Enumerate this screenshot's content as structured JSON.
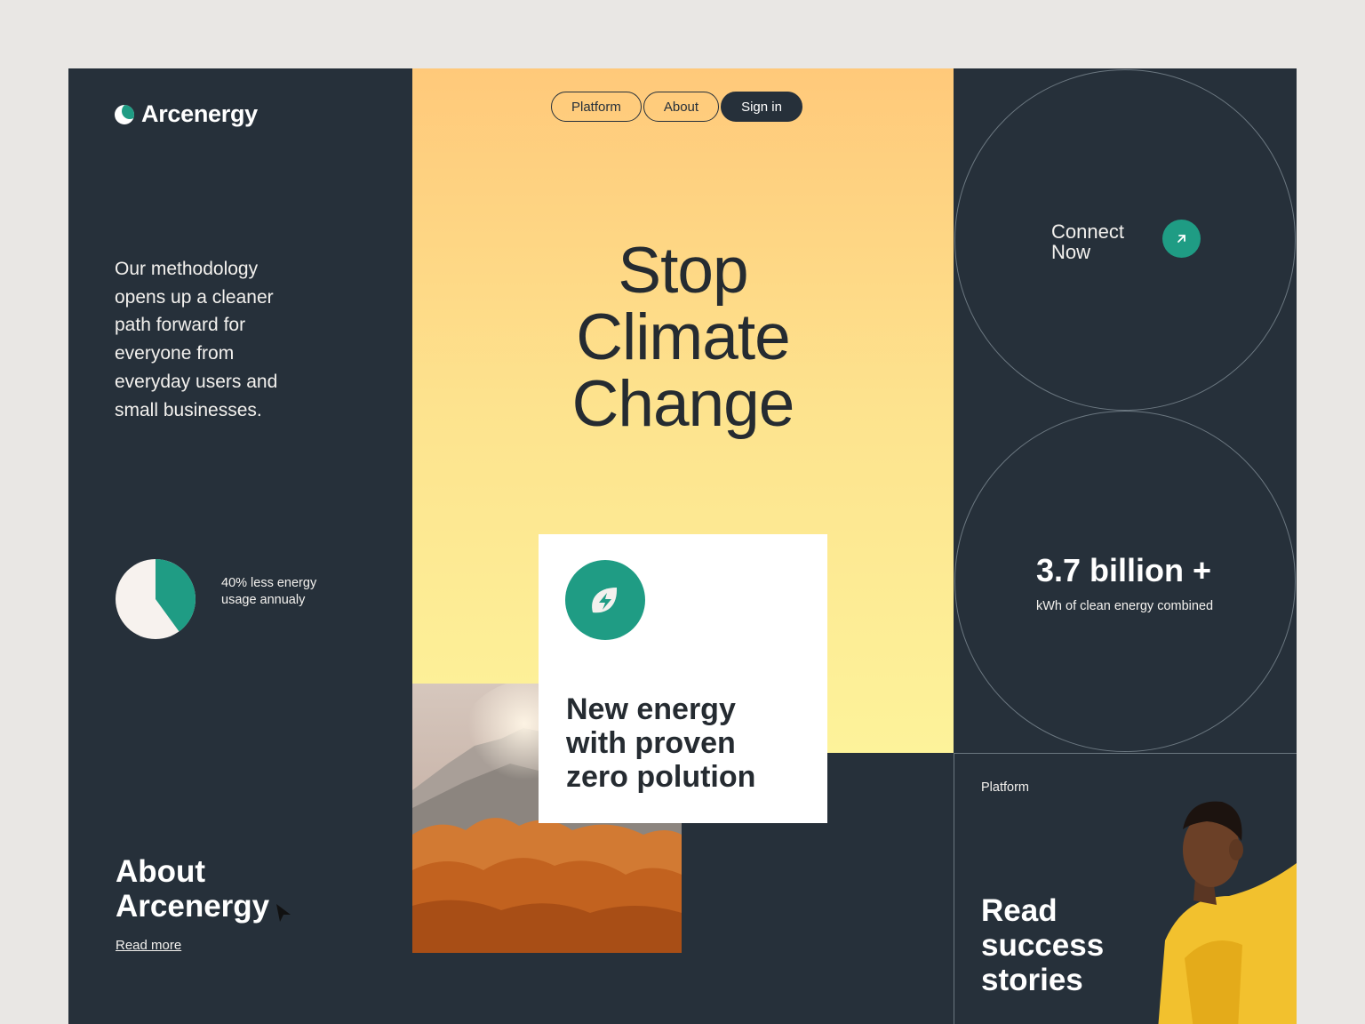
{
  "brand": {
    "name": "Arcenergy",
    "accent": "#1f9c84",
    "dark": "#26303a"
  },
  "nav": {
    "items": [
      "Platform",
      "About",
      "Sign in"
    ]
  },
  "left": {
    "methodology": "Our methodology opens up a cleaner path forward for everyone from everyday users and small businesses.",
    "pie": {
      "fraction": 0.4,
      "note": "40% less energy usage annualy"
    },
    "about_title": "About Arcenergy",
    "read_more": "Read more"
  },
  "hero": {
    "title_lines": [
      "Stop",
      "Climate",
      "Change"
    ],
    "card_text_lines": [
      "New energy",
      "with proven",
      "zero polution"
    ],
    "card_icon": "leaf-bolt-icon"
  },
  "right": {
    "connect_lines": [
      "Connect",
      "Now"
    ],
    "connect_icon": "arrow-up-right-icon",
    "stat_value": "3.7 billion +",
    "stat_label": "kWh of clean energy combined",
    "platform_label": "Platform",
    "stories_lines": [
      "Read",
      "success",
      "stories"
    ]
  }
}
